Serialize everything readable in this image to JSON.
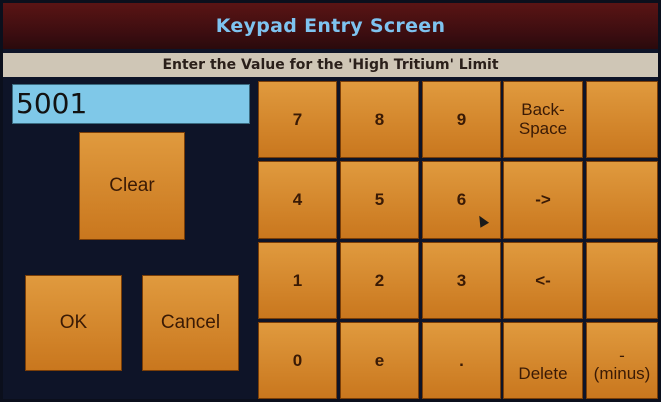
{
  "header": {
    "title": "Keypad Entry Screen"
  },
  "prompt": {
    "text": "Enter the Value for the 'High Tritium' Limit"
  },
  "entry": {
    "value": "5001"
  },
  "buttons": {
    "clear": "Clear",
    "ok": "OK",
    "cancel": "Cancel"
  },
  "keypad": {
    "k7": "7",
    "k8": "8",
    "k9": "9",
    "backspace_line1": "Back-",
    "backspace_line2": "Space",
    "k4": "4",
    "k5": "5",
    "k6": "6",
    "right_arrow": "->",
    "k1": "1",
    "k2": "2",
    "k3": "3",
    "left_arrow": "<-",
    "k0": "0",
    "ke": "e",
    "dot": ".",
    "delete": "Delete",
    "minus_line1": "-",
    "minus_line2": "(minus)"
  },
  "colors": {
    "title_bg": "#4a1012",
    "title_text": "#7ec3f0",
    "prompt_bg": "#cfc6b6",
    "button_orange": "#d88a30",
    "field_bg": "#7fc8e8",
    "screen_bg": "#0e1428"
  },
  "icons": {
    "pointer": "mouse-pointer-icon"
  }
}
